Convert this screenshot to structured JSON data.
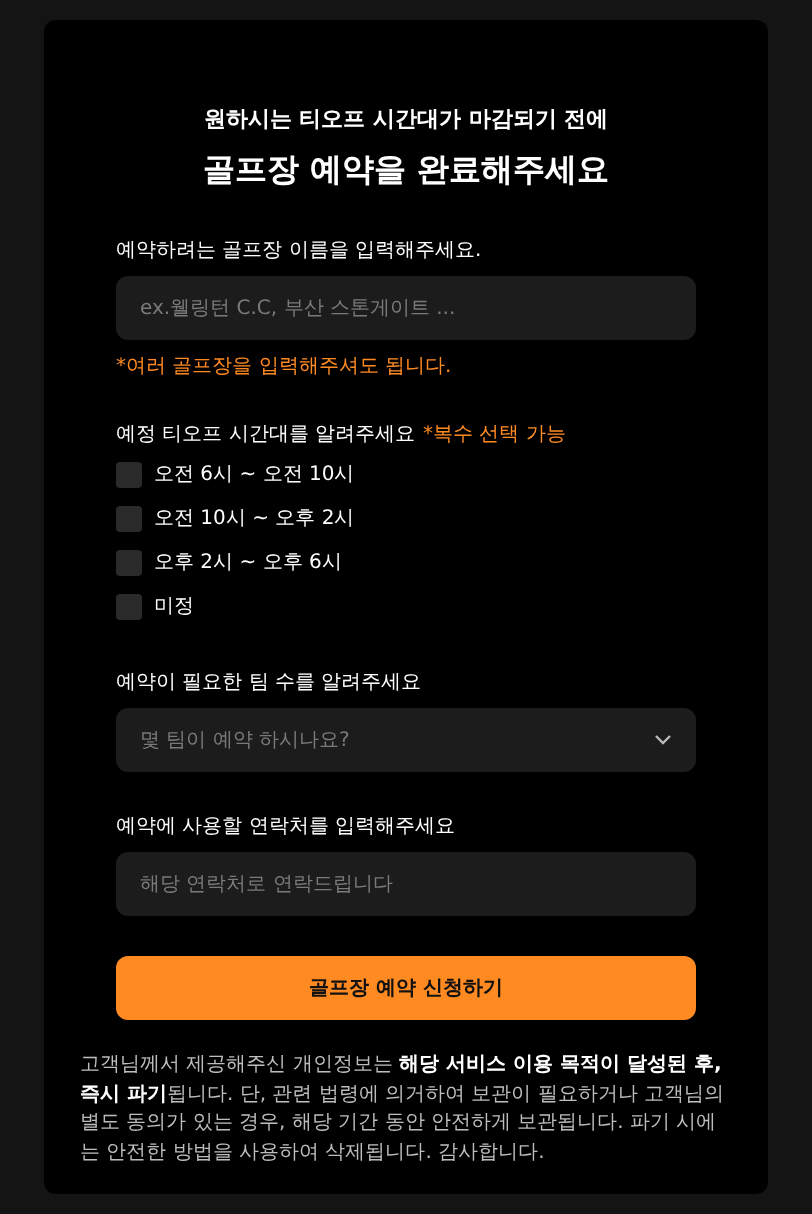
{
  "heading": {
    "subtitle": "원하시는 티오프 시간대가 마감되기 전에",
    "title": "골프장 예약을 완료해주세요"
  },
  "fields": [
    {
      "kind": "text",
      "label": "예약하려는 골프장 이름을 입력해주세요.",
      "placeholder": "ex.웰링턴 C.C, 부산 스톤게이트 ...",
      "note": "*여러 골프장을 입력해주셔도 됩니다."
    },
    {
      "kind": "checks",
      "label": "예정 티오프 시간대를 알려주세요",
      "hint": "*복수 선택 가능",
      "options": [
        {
          "label": "오전 6시 ~ 오전 10시",
          "checked": false
        },
        {
          "label": "오전 10시 ~ 오후 2시",
          "checked": false
        },
        {
          "label": "오후 2시 ~ 오후 6시",
          "checked": false
        },
        {
          "label": "미정",
          "checked": false
        }
      ]
    },
    {
      "kind": "select",
      "label": "예약이 필요한 팀 수를 알려주세요",
      "placeholder": "몇 팀이 예약 하시나요?"
    },
    {
      "kind": "text",
      "label": "예약에 사용할 연락처를 입력해주세요",
      "placeholder": "해당 연락처로 연락드립니다"
    }
  ],
  "submit_button": "골프장 예약 신청하기",
  "privacy_notice": "고객님께서 제공해주신 개인정보는 **해당 서비스 이용 목적이 달성된 후, 즉시 파기**됩니다. 단, 관련 법령에 의거하여 보관이 필요하거나 고객님의 별도 동의가 있는 경우, 해당 기간 동안 안전하게 보관됩니다. 파기 시에는 안전한 방법을 사용하여 삭제됩니다. 감사합니다."
}
